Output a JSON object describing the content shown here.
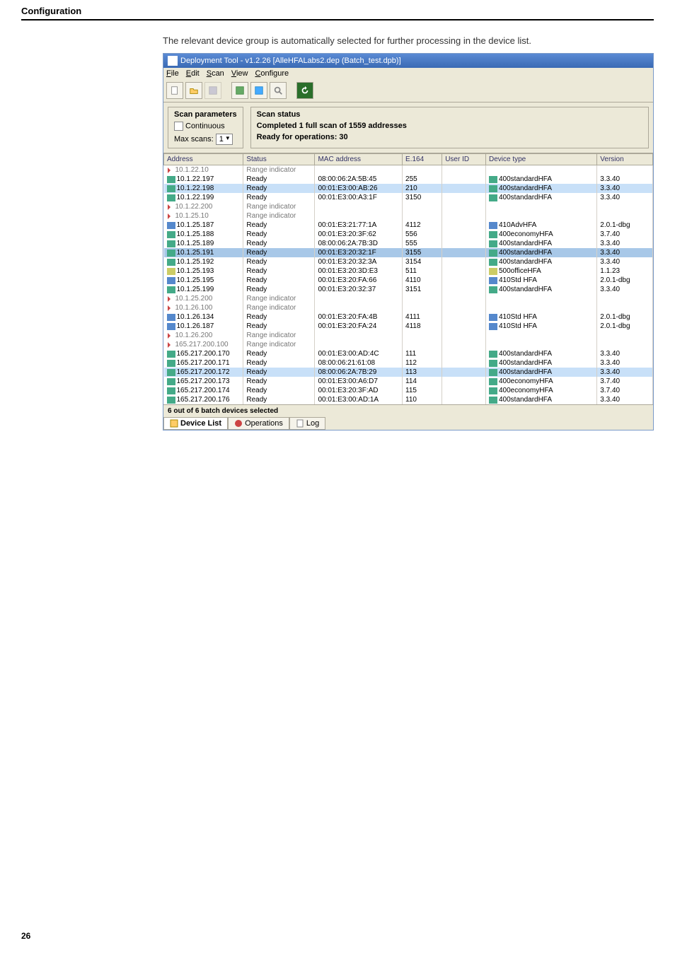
{
  "header": {
    "section_title": "Configuration"
  },
  "intro": "The relevant device group is automatically selected for further processing in the device list.",
  "window": {
    "title": "Deployment Tool - v1.2.26  [AlleHFALabs2.dep (Batch_test.dpb)]",
    "menu": [
      "File",
      "Edit",
      "Scan",
      "View",
      "Configure"
    ],
    "scan_params": {
      "title": "Scan parameters",
      "continuous": "Continuous",
      "max_scans_label": "Max scans:",
      "max_scans_value": "1"
    },
    "scan_status": {
      "title": "Scan status",
      "line1": "Completed 1 full scan of 1559 addresses",
      "line2": "Ready for operations: 30"
    },
    "columns": [
      "Address",
      "Status",
      "MAC address",
      "E.164",
      "User ID",
      "Device type",
      "Version"
    ],
    "rows": [
      {
        "addr": "10.1.22.10",
        "status": "Range indicator",
        "mac": "",
        "e164": "",
        "uid": "",
        "dtype": "",
        "ver": "",
        "cls": "range-ind",
        "ico": "arrow"
      },
      {
        "addr": "10.1.22.197",
        "status": "Ready",
        "mac": "08:00:06:2A:5B:45",
        "e164": "255",
        "uid": "",
        "dtype": "400standardHFA",
        "ver": "3.3.40",
        "ico": "g"
      },
      {
        "addr": "10.1.22.198",
        "status": "Ready",
        "mac": "00:01:E3:00:AB:26",
        "e164": "210",
        "uid": "",
        "dtype": "400standardHFA",
        "ver": "3.3.40",
        "cls": "hi-row",
        "ico": "g"
      },
      {
        "addr": "10.1.22.199",
        "status": "Ready",
        "mac": "00:01:E3:00:A3:1F",
        "e164": "3150",
        "uid": "",
        "dtype": "400standardHFA",
        "ver": "3.3.40",
        "ico": "g"
      },
      {
        "addr": "10.1.22.200",
        "status": "Range indicator",
        "mac": "",
        "e164": "",
        "uid": "",
        "dtype": "",
        "ver": "",
        "cls": "range-ind",
        "ico": "arrow"
      },
      {
        "addr": "10.1.25.10",
        "status": "Range indicator",
        "mac": "",
        "e164": "",
        "uid": "",
        "dtype": "",
        "ver": "",
        "cls": "range-ind",
        "ico": "arrow"
      },
      {
        "addr": "10.1.25.187",
        "status": "Ready",
        "mac": "00:01:E3:21:77:1A",
        "e164": "4112",
        "uid": "",
        "dtype": "410AdvHFA",
        "ver": "2.0.1-dbg",
        "ico": "b"
      },
      {
        "addr": "10.1.25.188",
        "status": "Ready",
        "mac": "00:01:E3:20:3F:62",
        "e164": "556",
        "uid": "",
        "dtype": "400economyHFA",
        "ver": "3.7.40",
        "ico": "g"
      },
      {
        "addr": "10.1.25.189",
        "status": "Ready",
        "mac": "08:00:06:2A:7B:3D",
        "e164": "555",
        "uid": "",
        "dtype": "400standardHFA",
        "ver": "3.3.40",
        "ico": "g"
      },
      {
        "addr": "10.1.25.191",
        "status": "Ready",
        "mac": "00:01:E3:20:32:1F",
        "e164": "3155",
        "uid": "",
        "dtype": "400standardHFA",
        "ver": "3.3.40",
        "cls": "sel-row",
        "ico": "g"
      },
      {
        "addr": "10.1.25.192",
        "status": "Ready",
        "mac": "00:01:E3:20:32:3A",
        "e164": "3154",
        "uid": "",
        "dtype": "400standardHFA",
        "ver": "3.3.40",
        "ico": "g"
      },
      {
        "addr": "10.1.25.193",
        "status": "Ready",
        "mac": "00:01:E3:20:3D:E3",
        "e164": "511",
        "uid": "",
        "dtype": "500officeHFA",
        "ver": "1.1.23",
        "ico": "y"
      },
      {
        "addr": "10.1.25.195",
        "status": "Ready",
        "mac": "00:01:E3:20:FA:66",
        "e164": "4110",
        "uid": "",
        "dtype": "410Std HFA",
        "ver": "2.0.1-dbg",
        "ico": "b"
      },
      {
        "addr": "10.1.25.199",
        "status": "Ready",
        "mac": "00:01:E3:20:32:37",
        "e164": "3151",
        "uid": "",
        "dtype": "400standardHFA",
        "ver": "3.3.40",
        "ico": "g"
      },
      {
        "addr": "10.1.25.200",
        "status": "Range indicator",
        "mac": "",
        "e164": "",
        "uid": "",
        "dtype": "",
        "ver": "",
        "cls": "range-ind",
        "ico": "arrow"
      },
      {
        "addr": "10.1.26.100",
        "status": "Range indicator",
        "mac": "",
        "e164": "",
        "uid": "",
        "dtype": "",
        "ver": "",
        "cls": "range-ind",
        "ico": "arrow"
      },
      {
        "addr": "10.1.26.134",
        "status": "Ready",
        "mac": "00:01:E3:20:FA:4B",
        "e164": "4111",
        "uid": "",
        "dtype": "410Std HFA",
        "ver": "2.0.1-dbg",
        "ico": "b"
      },
      {
        "addr": "10.1.26.187",
        "status": "Ready",
        "mac": "00:01:E3:20:FA:24",
        "e164": "4118",
        "uid": "",
        "dtype": "410Std HFA",
        "ver": "2.0.1-dbg",
        "ico": "b"
      },
      {
        "addr": "10.1.26.200",
        "status": "Range indicator",
        "mac": "",
        "e164": "",
        "uid": "",
        "dtype": "",
        "ver": "",
        "cls": "range-ind",
        "ico": "arrow"
      },
      {
        "addr": "165.217.200.100",
        "status": "Range indicator",
        "mac": "",
        "e164": "",
        "uid": "",
        "dtype": "",
        "ver": "",
        "cls": "range-ind",
        "ico": "arrow"
      },
      {
        "addr": "165.217.200.170",
        "status": "Ready",
        "mac": "00:01:E3:00:AD:4C",
        "e164": "111",
        "uid": "",
        "dtype": "400standardHFA",
        "ver": "3.3.40",
        "ico": "g"
      },
      {
        "addr": "165.217.200.171",
        "status": "Ready",
        "mac": "08:00:06:21:61:08",
        "e164": "112",
        "uid": "",
        "dtype": "400standardHFA",
        "ver": "3.3.40",
        "ico": "g"
      },
      {
        "addr": "165.217.200.172",
        "status": "Ready",
        "mac": "08:00:06:2A:7B:29",
        "e164": "113",
        "uid": "",
        "dtype": "400standardHFA",
        "ver": "3.3.40",
        "cls": "hi-row",
        "ico": "g"
      },
      {
        "addr": "165.217.200.173",
        "status": "Ready",
        "mac": "00:01:E3:00:A6:D7",
        "e164": "114",
        "uid": "",
        "dtype": "400economyHFA",
        "ver": "3.7.40",
        "ico": "g"
      },
      {
        "addr": "165.217.200.174",
        "status": "Ready",
        "mac": "00:01:E3:20:3F:AD",
        "e164": "115",
        "uid": "",
        "dtype": "400economyHFA",
        "ver": "3.7.40",
        "ico": "g"
      },
      {
        "addr": "165.217.200.176",
        "status": "Ready",
        "mac": "00:01:E3:00:AD:1A",
        "e164": "110",
        "uid": "",
        "dtype": "400standardHFA",
        "ver": "3.3.40",
        "ico": "g"
      }
    ],
    "footer_status": "6 out of 6 batch devices selected",
    "tabs": [
      {
        "label": "Device List",
        "active": true
      },
      {
        "label": "Operations",
        "active": false
      },
      {
        "label": "Log",
        "active": false
      }
    ]
  },
  "page_number": "26"
}
